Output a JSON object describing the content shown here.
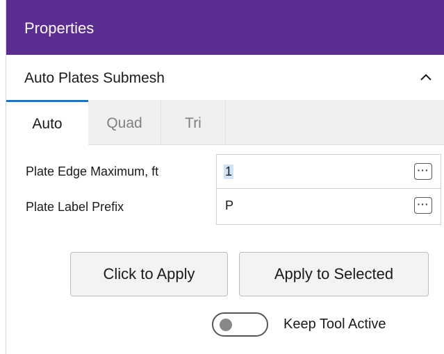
{
  "header": {
    "title": "Properties"
  },
  "section": {
    "title": "Auto Plates Submesh",
    "collapse_icon": "chevron-up-icon"
  },
  "tabs": [
    {
      "label": "Auto",
      "active": true
    },
    {
      "label": "Quad",
      "active": false
    },
    {
      "label": "Tri",
      "active": false
    }
  ],
  "properties": [
    {
      "label": "Plate Edge Maximum, ft",
      "value": "1",
      "selected": true,
      "action_label": "···"
    },
    {
      "label": "Plate Label Prefix",
      "value": "P",
      "selected": false,
      "action_label": "···"
    }
  ],
  "buttons": {
    "click_to_apply": "Click to Apply",
    "apply_to_selected": "Apply to Selected"
  },
  "toggle": {
    "label": "Keep Tool Active",
    "on": false
  },
  "colors": {
    "header_bg": "#5b2d91",
    "active_tab_accent": "#1e73c9",
    "selection": "#cfe3f7"
  }
}
